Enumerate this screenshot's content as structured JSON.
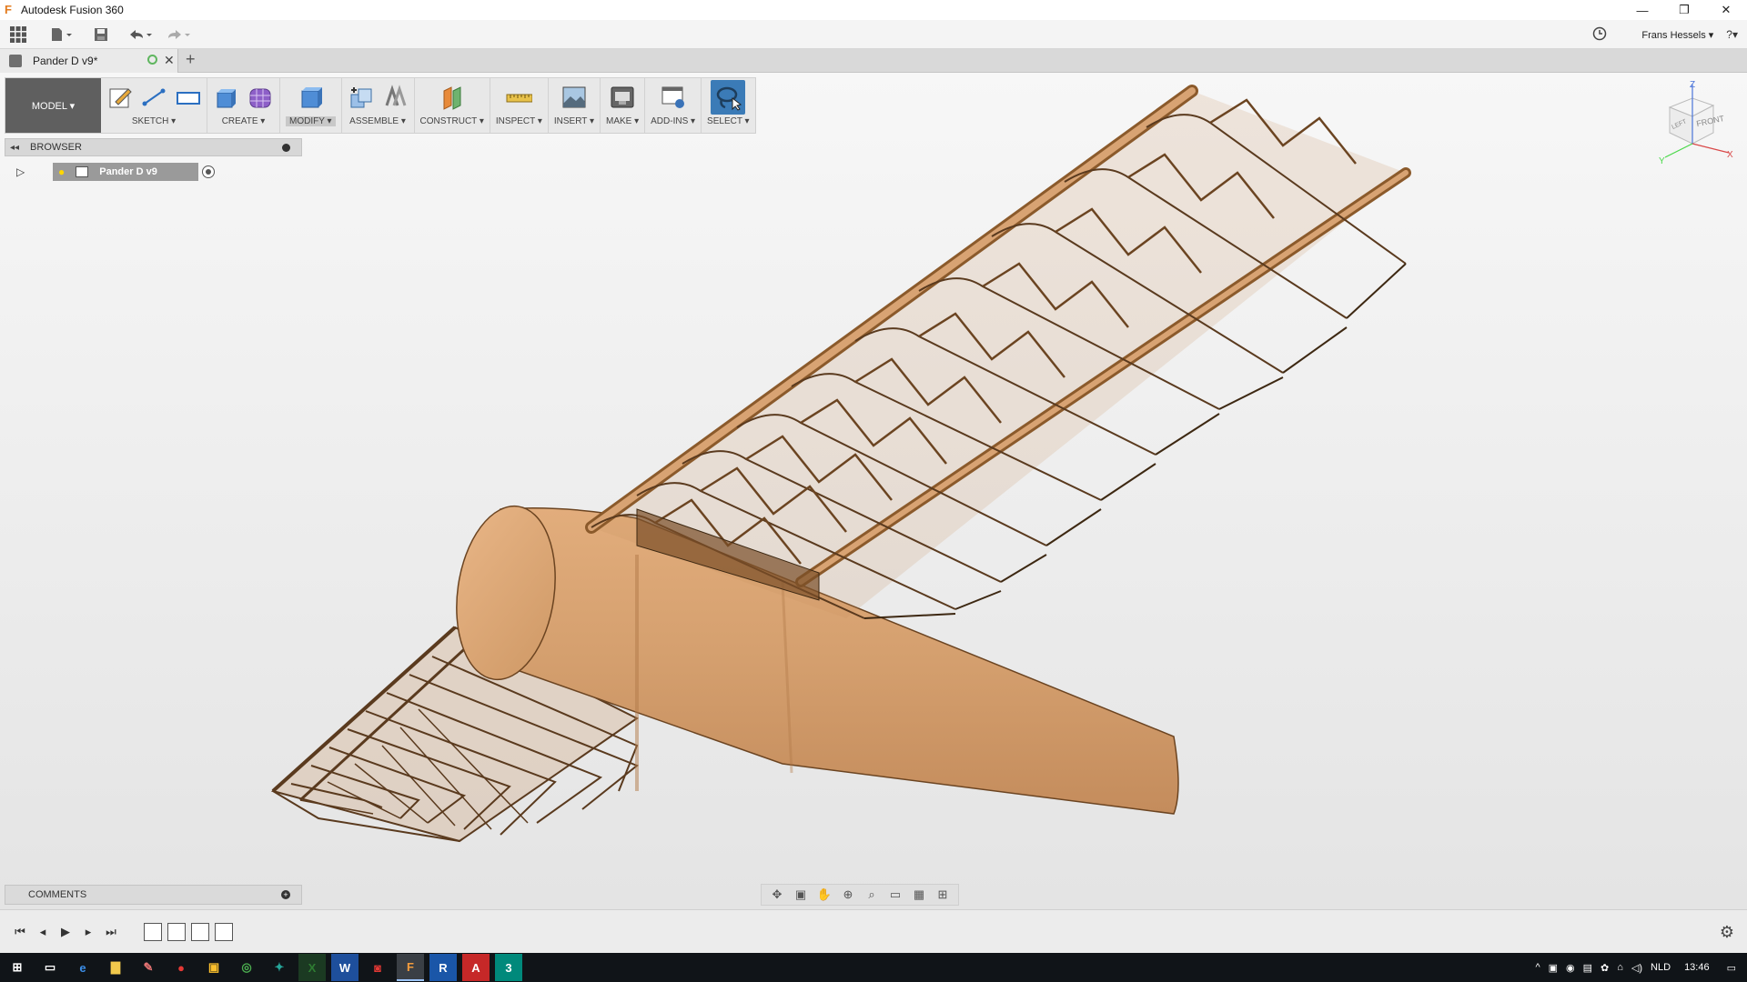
{
  "window": {
    "title": "Autodesk Fusion 360",
    "controls": [
      "—",
      "❐",
      "✕"
    ]
  },
  "qat": {
    "user": "Frans Hessels ▾",
    "help": "?▾"
  },
  "tab": {
    "title": "Pander D v9*",
    "close": "✕",
    "new": "+"
  },
  "toolbar": {
    "workspace": "MODEL ▾",
    "groups": {
      "sketch": "SKETCH ▾",
      "create": "CREATE ▾",
      "modify": "MODIFY ▾",
      "assemble": "ASSEMBLE ▾",
      "construct": "CONSTRUCT ▾",
      "inspect": "INSPECT ▾",
      "insert": "INSERT ▾",
      "make": "MAKE ▾",
      "addins": "ADD-INS ▾",
      "select": "SELECT ▾"
    }
  },
  "browser": {
    "title": "BROWSER",
    "root": "Pander D v9"
  },
  "comments": {
    "title": "COMMENTS",
    "add": "+"
  },
  "viewcube": {
    "front": "FRONT",
    "left": "LEFT",
    "axis_x": "X",
    "axis_y": "Y",
    "axis_z": "Z"
  },
  "taskbar": {
    "apps": [
      {
        "name": "start",
        "glyph": "⊞"
      },
      {
        "name": "task-view",
        "glyph": "▭"
      },
      {
        "name": "edge",
        "glyph": "e"
      },
      {
        "name": "explorer",
        "glyph": "▇"
      },
      {
        "name": "paint",
        "glyph": "✎"
      },
      {
        "name": "app-red",
        "glyph": "●"
      },
      {
        "name": "app-yellow",
        "glyph": "▣"
      },
      {
        "name": "chrome",
        "glyph": "◎"
      },
      {
        "name": "app-green",
        "glyph": "✦"
      },
      {
        "name": "excel",
        "glyph": "X"
      },
      {
        "name": "word",
        "glyph": "W"
      },
      {
        "name": "app-red2",
        "glyph": "◙"
      },
      {
        "name": "fusion",
        "glyph": "F"
      },
      {
        "name": "revit",
        "glyph": "R"
      },
      {
        "name": "acrobat",
        "glyph": "A"
      },
      {
        "name": "app-teal",
        "glyph": "3"
      }
    ],
    "language": "NLD",
    "time": "13:46"
  },
  "colors": {
    "accent": "#3b7bb7",
    "wood": "#d6a070",
    "wood_dark": "#8b5a2b",
    "taskbar": "#101418"
  }
}
